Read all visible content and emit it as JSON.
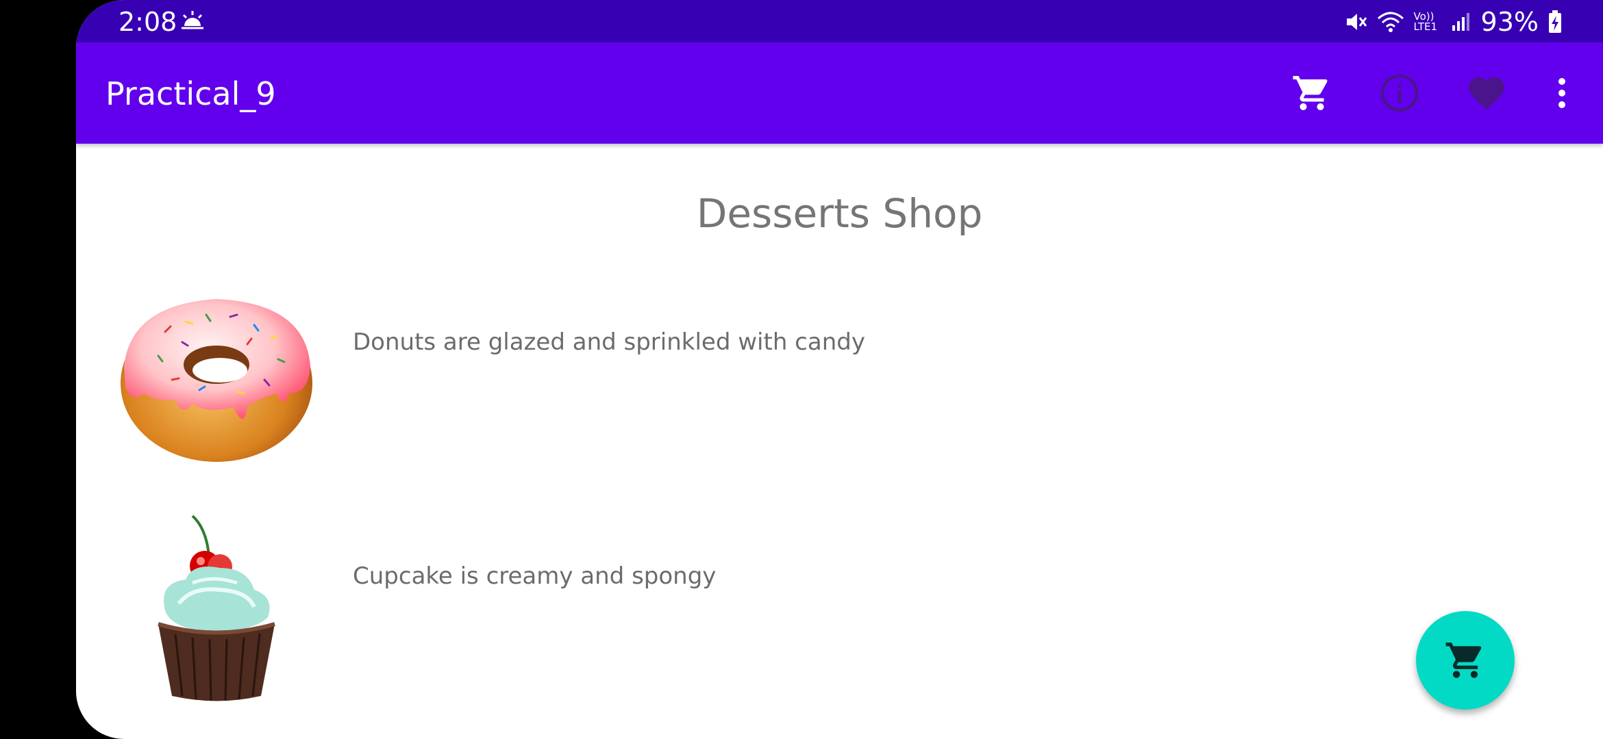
{
  "status_bar": {
    "time": "2:08",
    "battery": "93%",
    "network_label": "Vo)) LTE1"
  },
  "app_bar": {
    "title": "Practical_9",
    "actions": [
      "cart-icon",
      "info-icon",
      "heart-icon",
      "more-vert-icon"
    ]
  },
  "main": {
    "shop_title": "Desserts Shop",
    "items": [
      {
        "image": "donut-image",
        "description": "Donuts are glazed and sprinkled with candy"
      },
      {
        "image": "cupcake-image",
        "description": "Cupcake is creamy and spongy"
      }
    ]
  },
  "fab": {
    "icon": "cart-icon"
  },
  "colors": {
    "status_bar": "#3700B3",
    "app_bar": "#6200EE",
    "fab": "#03DAC5",
    "heart": "#4a148c"
  }
}
